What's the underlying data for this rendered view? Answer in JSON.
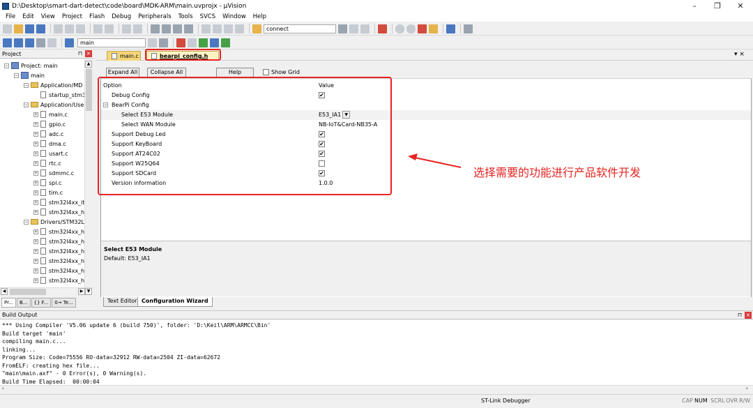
{
  "window": {
    "title": "D:\\Desktop\\smart-dart-detect\\code\\board\\MDK-ARM\\main.uvprojx - µVision",
    "minimize": "–",
    "restore": "❐",
    "close": "✕"
  },
  "menu": [
    "File",
    "Edit",
    "View",
    "Project",
    "Flash",
    "Debug",
    "Peripherals",
    "Tools",
    "SVCS",
    "Window",
    "Help"
  ],
  "toolbar1": {
    "search_combo": "connect"
  },
  "toolbar2": {
    "target_combo": "main"
  },
  "project": {
    "title": "Project",
    "pin": "⊓",
    "close": "×",
    "tree": [
      {
        "label": "Project: main",
        "kind": "root"
      },
      {
        "label": "main",
        "kind": "target"
      },
      {
        "label": "Application/MD",
        "kind": "folder"
      },
      {
        "label": "startup_stm3",
        "kind": "file"
      },
      {
        "label": "Application/Use",
        "kind": "folder"
      },
      {
        "label": "main.c",
        "kind": "file"
      },
      {
        "label": "gpio.c",
        "kind": "file"
      },
      {
        "label": "adc.c",
        "kind": "file"
      },
      {
        "label": "dma.c",
        "kind": "file"
      },
      {
        "label": "usart.c",
        "kind": "file"
      },
      {
        "label": "rtc.c",
        "kind": "file"
      },
      {
        "label": "sdmmc.c",
        "kind": "file"
      },
      {
        "label": "spi.c",
        "kind": "file"
      },
      {
        "label": "tim.c",
        "kind": "file"
      },
      {
        "label": "stm32l4xx_it",
        "kind": "file"
      },
      {
        "label": "stm32l4xx_h",
        "kind": "file"
      },
      {
        "label": "Drivers/STM32L4",
        "kind": "folder"
      },
      {
        "label": "stm32l4xx_h",
        "kind": "file"
      },
      {
        "label": "stm32l4xx_h",
        "kind": "file"
      },
      {
        "label": "stm32l4xx_h",
        "kind": "file"
      },
      {
        "label": "stm32l4xx_h",
        "kind": "file"
      },
      {
        "label": "stm32l4xx_h",
        "kind": "file"
      },
      {
        "label": "stm32l4xx_h",
        "kind": "file"
      }
    ],
    "tabs": [
      "Pr...",
      "B...",
      "{} F...",
      "0→ Te..."
    ]
  },
  "editor": {
    "tabs": [
      "main.c",
      "bearpi_config.h"
    ],
    "panel_menu": "▾ ×"
  },
  "config": {
    "expand_all": "Expand All",
    "collapse_all": "Collapse All",
    "help": "Help",
    "show_grid": "Show Grid",
    "col_option": "Option",
    "col_value": "Value",
    "rows": [
      {
        "option": "Debug Config",
        "value": "✔",
        "type": "check",
        "level": 0
      },
      {
        "option": "BearPi Config",
        "value": "",
        "type": "group",
        "level": 0
      },
      {
        "option": "Select E53 Module",
        "value": "E53_IA1",
        "type": "combo",
        "level": 1
      },
      {
        "option": "Select WAN Module",
        "value": "NB-IoT&Card-NB35-A",
        "type": "text",
        "level": 1
      },
      {
        "option": "Support Debug Led",
        "value": "✔",
        "type": "check",
        "level": 0
      },
      {
        "option": "Support KeyBoard",
        "value": "✔",
        "type": "check",
        "level": 0
      },
      {
        "option": "Support AT24C02",
        "value": "✔",
        "type": "check",
        "level": 0
      },
      {
        "option": "Support W25Q64",
        "value": "",
        "type": "check",
        "level": 0
      },
      {
        "option": "Support SDCard",
        "value": "✔",
        "type": "check",
        "level": 0
      },
      {
        "option": "Version information",
        "value": "1.0.0",
        "type": "text",
        "level": 0
      }
    ],
    "desc_title": "Select E53 Module",
    "desc_text": "Default: E53_IA1",
    "bottom_tabs": [
      "Text Editor",
      "Configuration Wizard"
    ]
  },
  "annotation": {
    "text": "选择需要的功能进行产品软件开发",
    "color": "#e52420"
  },
  "build": {
    "title": "Build Output",
    "lines": [
      "*** Using Compiler 'V5.06 update 6 (build 750)', folder: 'D:\\Keil\\ARM\\ARMCC\\Bin'",
      "Build target 'main'",
      "compiling main.c...",
      "linking...",
      "Program Size: Code=75556 RO-data=32912 RW-data=2504 ZI-data=62672",
      "FromELF: creating hex file...",
      "\"main\\main.axf\" - 0 Error(s), 0 Warning(s).",
      "Build Time Elapsed:  00:00:04"
    ]
  },
  "status": {
    "debugger": "ST-Link Debugger",
    "indicators": [
      "CAP",
      "NUM",
      "SCRL",
      "OVR",
      "R/W"
    ]
  }
}
